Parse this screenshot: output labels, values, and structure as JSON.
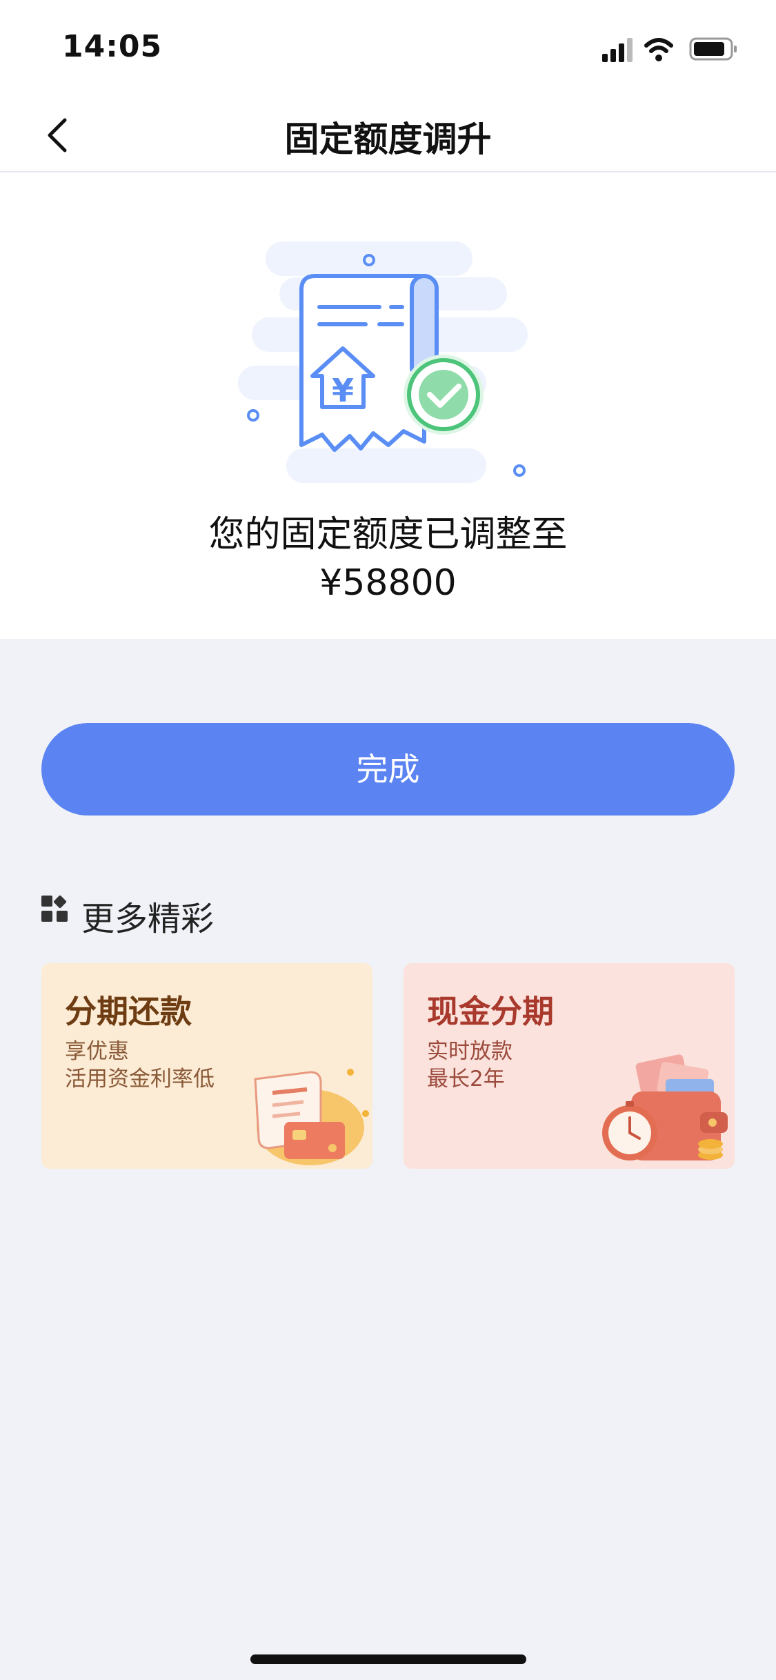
{
  "status_bar": {
    "time": "14:05",
    "icons": [
      "cellular-signal-icon",
      "wifi-icon",
      "battery-icon"
    ]
  },
  "nav": {
    "back_icon": "chevron-left-icon",
    "title": "固定额度调升"
  },
  "result": {
    "illustration": "receipt-success-illustration",
    "message": "您的固定额度已调整至",
    "amount": "¥58800"
  },
  "done_button": {
    "label": "完成"
  },
  "more": {
    "icon": "grid-apps-icon",
    "title": "更多精彩",
    "cards": [
      {
        "title": "分期还款",
        "line1": "享优惠",
        "line2": "活用资金利率低",
        "art": "bill-card-illustration"
      },
      {
        "title": "现金分期",
        "line1": "实时放款",
        "line2": "最长2年",
        "art": "wallet-clock-illustration"
      }
    ]
  },
  "colors": {
    "accent": "#5b84f2",
    "background": "#f0f2f7",
    "card_installment_bg": "#fcecd5",
    "card_cash_bg": "#fbe2dc"
  }
}
